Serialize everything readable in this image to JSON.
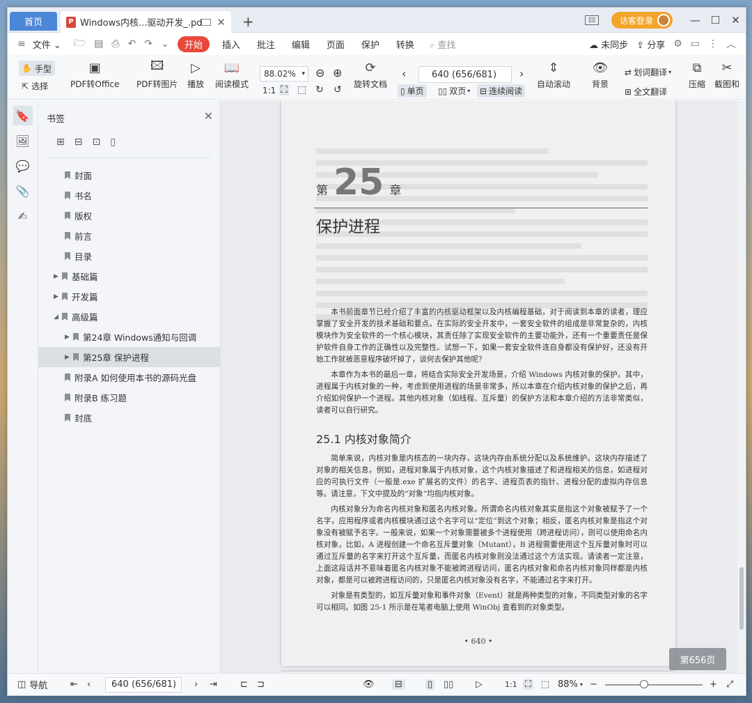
{
  "titlebar": {
    "home_tab": "首页",
    "doc_tab_icon": "P",
    "doc_tab": "Windows内核...驱动开发_.pdf",
    "login": "访客登录"
  },
  "menu": {
    "file": "文件",
    "items": [
      "开始",
      "插入",
      "批注",
      "编辑",
      "页面",
      "保护",
      "转换"
    ],
    "search": "查找",
    "sync": "未同步",
    "share": "分享"
  },
  "toolbar": {
    "hand": "手型",
    "select": "选择",
    "pdf_to_office": "PDF转Office",
    "pdf_to_image": "PDF转图片",
    "play": "播放",
    "read_mode": "阅读模式",
    "zoom": "88.02%",
    "rotate_doc": "旋转文档",
    "page_input": "640 (656/681)",
    "single_page": "单页",
    "double_page": "双页",
    "continuous": "连续阅读",
    "auto_scroll": "自动滚动",
    "background": "背景",
    "word_translate": "划词翻译",
    "full_translate": "全文翻译",
    "compress": "压缩",
    "screenshot": "截图和"
  },
  "panel": {
    "title": "书签",
    "bookmarks": [
      {
        "label": "封面",
        "indent": 0,
        "arrow": ""
      },
      {
        "label": "书名",
        "indent": 0,
        "arrow": ""
      },
      {
        "label": "版权",
        "indent": 0,
        "arrow": ""
      },
      {
        "label": "前言",
        "indent": 0,
        "arrow": ""
      },
      {
        "label": "目录",
        "indent": 0,
        "arrow": ""
      },
      {
        "label": "基础篇",
        "indent": 0,
        "arrow": "▶"
      },
      {
        "label": "开发篇",
        "indent": 0,
        "arrow": "▶"
      },
      {
        "label": "高级篇",
        "indent": 0,
        "arrow": "◢"
      },
      {
        "label": "第24章  Windows通知与回调",
        "indent": 1,
        "arrow": "▶"
      },
      {
        "label": "第25章  保护进程",
        "indent": 1,
        "arrow": "▶",
        "selected": true
      },
      {
        "label": "附录A  如何使用本书的源码光盘",
        "indent": 0,
        "arrow": ""
      },
      {
        "label": "附录B  练习题",
        "indent": 0,
        "arrow": ""
      },
      {
        "label": "封底",
        "indent": 0,
        "arrow": ""
      }
    ]
  },
  "document": {
    "chapter_prefix": "第",
    "chapter_number": "25",
    "chapter_suffix": "章",
    "chapter_title": "保护进程",
    "intro_paragraphs": [
      "本书前面章节已经介绍了丰富的内核驱动框架以及内核编程基础，对于阅读到本章的读者，理应掌握了安全开发的技术基础和要点。在实际的安全开发中，一套安全软件的组成是非常复杂的，内核模块作为安全软件的一个核心模块，其责任除了实现安全软件的主要功能外，还有一个重要责任是保护软件自身工作的正确性以及完整性。试想一下，如果一套安全软件连自身都没有保护好，还没有开始工作就被恶意程序破坏掉了，谈何去保护其他呢？",
      "本章作为本书的最后一章，将结合实际安全开发场景，介绍 Windows 内核对象的保护。其中，进程属于内核对象的一种，考虑到使用进程的场景非常多，所以本章在介绍内核对象的保护之后，再介绍如何保护一个进程。其他内核对象（如线程、互斥量）的保护方法和本章介绍的方法非常类似，读者可以自行研究。"
    ],
    "section_title": "25.1   内核对象简介",
    "section_paragraphs": [
      "简单来说，内核对象是内核态的一块内存，这块内存由系统分配以及系统维护。这块内存描述了对象的相关信息，例如，进程对象属于内核对象，这个内核对象描述了和进程相关的信息，如进程对应的可执行文件（一般是.exe 扩展名的文件）的名字、进程页表的指针、进程分配的虚拟内存信息等。请注意，下文中提及的“对象”均指内核对象。",
      "内核对象分为命名内核对象和匿名内核对象。所谓命名内核对象其实是指这个对象被赋予了一个名字，应用程序或者内核模块通过这个名字可以“定位”到这个对象；相反，匿名内核对象是指这个对象没有被赋予名字。一般来说，如果一个对象需要被多个进程使用（跨进程访问），则可以使用命名内核对象，比如，A 进程创建一个命名互斥量对象（Mutant），B 进程需要使用这个互斥量对象时可以通过互斥量的名字来打开这个互斥量，而匿名内核对象则没法通过这个方法实现。请读者一定注意，上面这段话并不意味着匿名内核对象不能被跨进程访问，匿名内核对象和命名内核对象同样都是内核对象，都是可以被跨进程访问的，只是匿名内核对象没有名字，不能通过名字来打开。",
      "对象是有类型的，如互斥量对象和事件对象（Event）就是两种类型的对象，不同类型对象的名字可以相同。如图 25-1 所示是在笔者电脑上使用 WinObj 查看到的对象类型。"
    ],
    "page_number": "• 640 •",
    "page_badge": "第656页"
  },
  "statusbar": {
    "nav": "导航",
    "page_input": "640 (656/681)",
    "zoom": "88%",
    "zoom_fraction": 0.4
  }
}
